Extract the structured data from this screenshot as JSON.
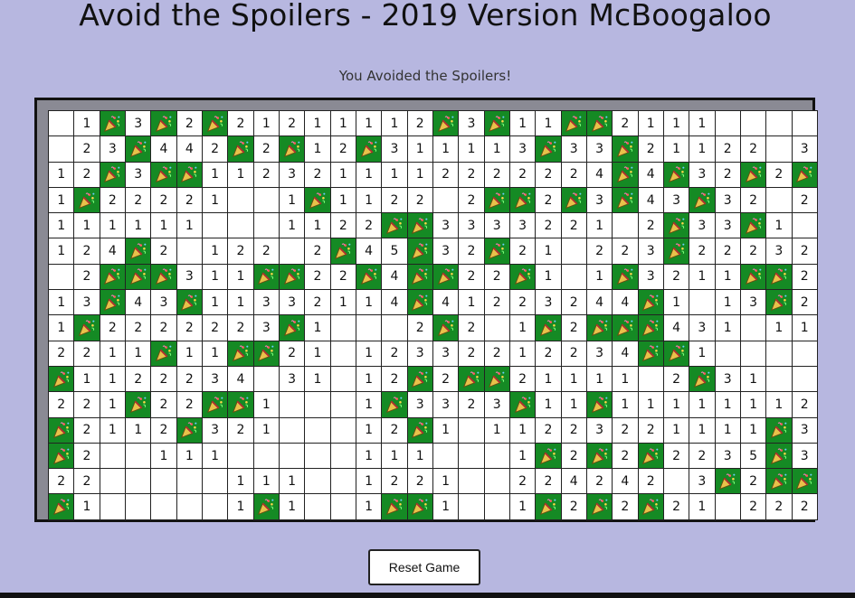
{
  "title": "Avoid the Spoilers - 2019 Version McBoogaloo",
  "status": "You Avoided the Spoilers!",
  "reset_label": "Reset Game",
  "mine_icon": "party-popper-icon",
  "colors": {
    "background": "#b7b7e0",
    "mine_cell": "#158a24",
    "cell": "#ffffff",
    "frame": "#8a8a94"
  },
  "board": {
    "cols": 30,
    "rows": [
      " 1M3M2M21211112M3M11MM2111      ",
      " 23M442M2M12M311113M33M21122 32",
      "12M3MM1123211112222224M4M32M2MMM",
      "1M22221  1M1122 2MM2M3M43M32 2 43",
      "111111   1122MM3333221 2M33M1  1M",
      "124M2 122 2M45M32M21 223M22232",
      " 2MMM311MM22M4MM22M1 1M3211MM2",
      "13M43M11332114M41223244M1 13M2",
      "1M2222223M1   2M2 1M2MMM431 111",
      "2211M11MM21 12332212234MM1    ",
      "M1122234 31 12M2MM21111 2M31    ",
      "221M22MM1   1M3323M11M1111111211",
      "M2112M321   12M1 11223221111M3M2",
      "M2  111     111   1M2M2M2235M3",
      "22     111  1221  224242 3M2MM2",
      "M1     1M1  1MM1  1M2M2M21 2221"
    ]
  }
}
